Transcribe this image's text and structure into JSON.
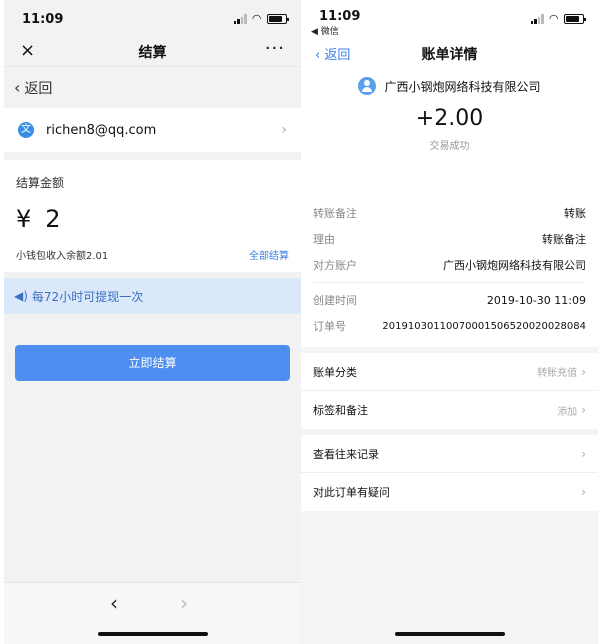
{
  "left": {
    "status_time": "11:09",
    "title": "结算",
    "close": "×",
    "more": "···",
    "back": "返回",
    "account_email": "richen8@qq.com",
    "amount_label": "结算金额",
    "currency": "¥",
    "amount": "2",
    "balance_text": "小钱包收入余额2.01",
    "all_settle": "全部结算",
    "notice": "每72小时可提现一次",
    "primary_button": "立即结算",
    "nav_prev": "‹",
    "nav_next": "›"
  },
  "right": {
    "status_time": "11:09",
    "status_sub": "◀ 微信",
    "back": "返回",
    "title": "账单详情",
    "merchant": "广西小钢炮网络科技有限公司",
    "amount": "+2.00",
    "status": "交易成功",
    "details": [
      {
        "k": "转账备注",
        "v": "转账"
      },
      {
        "k": "理由",
        "v": "转账备注"
      },
      {
        "k": "对方账户",
        "v": "广西小钢炮网络科技有限公司"
      }
    ],
    "details2": [
      {
        "k": "创建时间",
        "v": "2019-10-30 11:09"
      },
      {
        "k": "订单号",
        "v": "20191030110070001506520020028084"
      }
    ],
    "menu1": [
      {
        "label": "账单分类",
        "extra": "转账充值"
      },
      {
        "label": "标签和备注",
        "extra": "添加"
      }
    ],
    "menu2": [
      {
        "label": "查看往来记录",
        "extra": ""
      },
      {
        "label": "对此订单有疑问",
        "extra": ""
      }
    ]
  },
  "colors": {
    "accent": "#4d8ef0",
    "link": "#3a7ee6",
    "notice_bg": "#dbe8fa"
  }
}
